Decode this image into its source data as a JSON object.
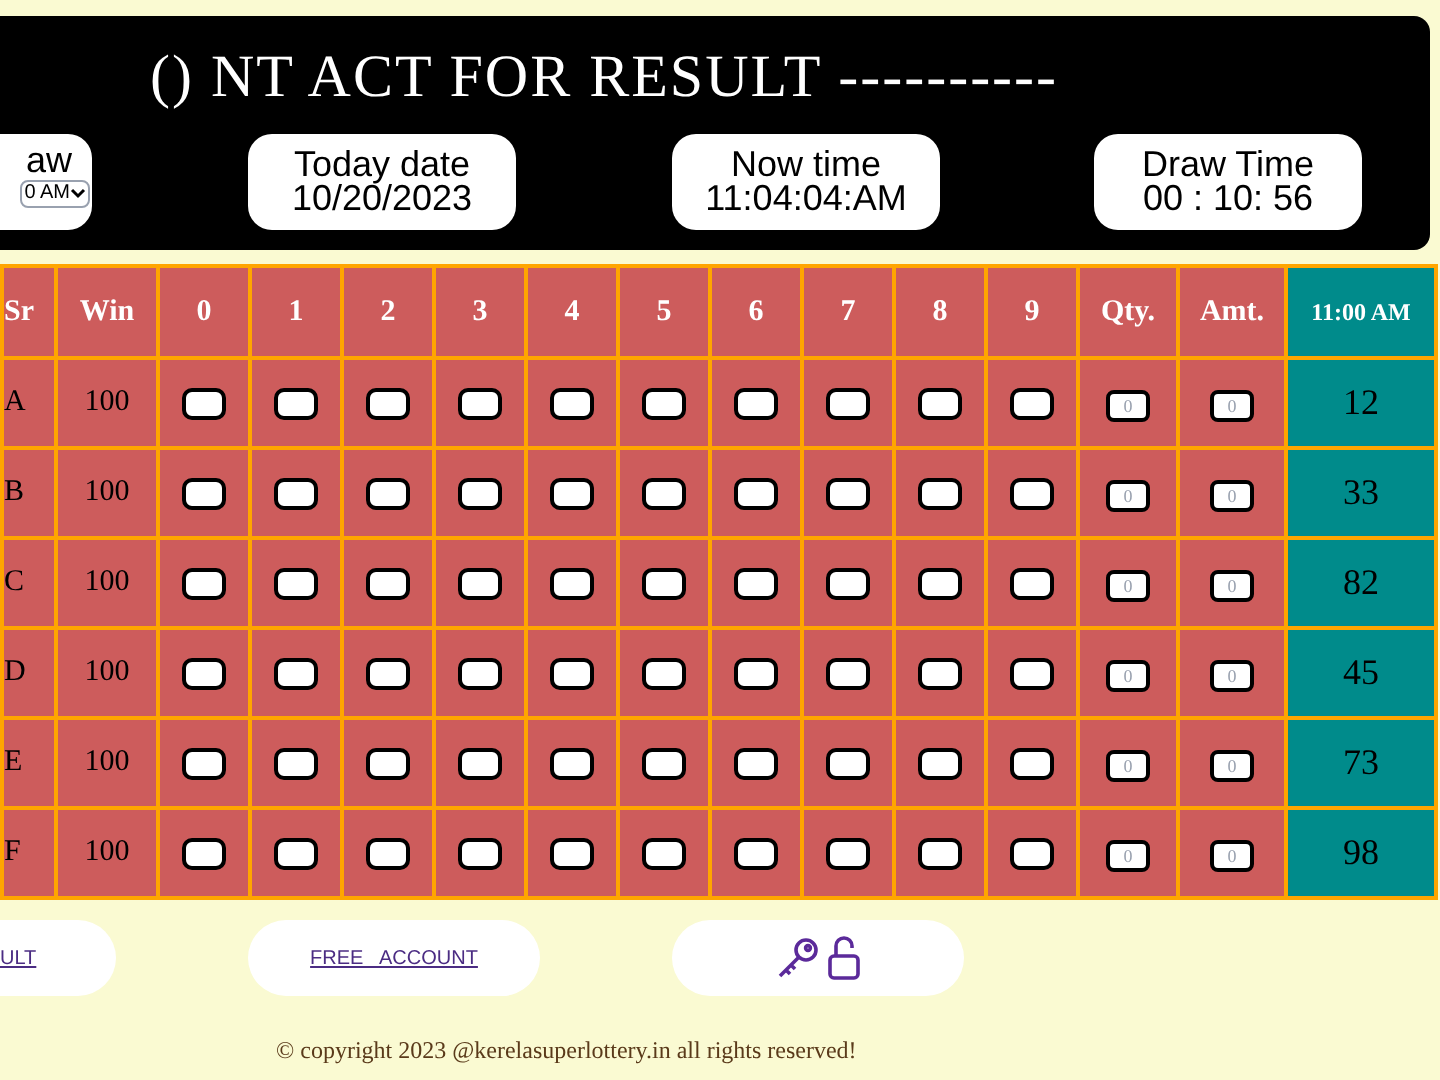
{
  "header": {
    "title": "() NT ACT FOR RESULT ----------",
    "draw_box": {
      "label": "aw",
      "select_value": "0 AM"
    },
    "info_boxes": [
      {
        "label": "Today date",
        "value": "10/20/2023"
      },
      {
        "label": "Now time",
        "value": "11:04:04:AM"
      },
      {
        "label": "Draw Time",
        "value": "00 : 10: 56"
      }
    ]
  },
  "table": {
    "columns": [
      "Sr",
      "Win",
      "0",
      "1",
      "2",
      "3",
      "4",
      "5",
      "6",
      "7",
      "8",
      "9",
      "Qty.",
      "Amt.",
      "11:00 AM"
    ],
    "rows": [
      {
        "sr": "A",
        "win": "100",
        "qty_placeholder": "0",
        "amt_placeholder": "0",
        "result": "12"
      },
      {
        "sr": "B",
        "win": "100",
        "qty_placeholder": "0",
        "amt_placeholder": "0",
        "result": "33"
      },
      {
        "sr": "C",
        "win": "100",
        "qty_placeholder": "0",
        "amt_placeholder": "0",
        "result": "82"
      },
      {
        "sr": "D",
        "win": "100",
        "qty_placeholder": "0",
        "amt_placeholder": "0",
        "result": "45"
      },
      {
        "sr": "E",
        "win": "100",
        "qty_placeholder": "0",
        "amt_placeholder": "0",
        "result": "73"
      },
      {
        "sr": "F",
        "win": "100",
        "qty_placeholder": "0",
        "amt_placeholder": "0",
        "result": "98"
      }
    ]
  },
  "bottom_links": [
    "ULT",
    "FREE   ACCOUNT"
  ],
  "copyright": "© copyright 2023 @kerelasuperlottery.in all rights reserved!"
}
